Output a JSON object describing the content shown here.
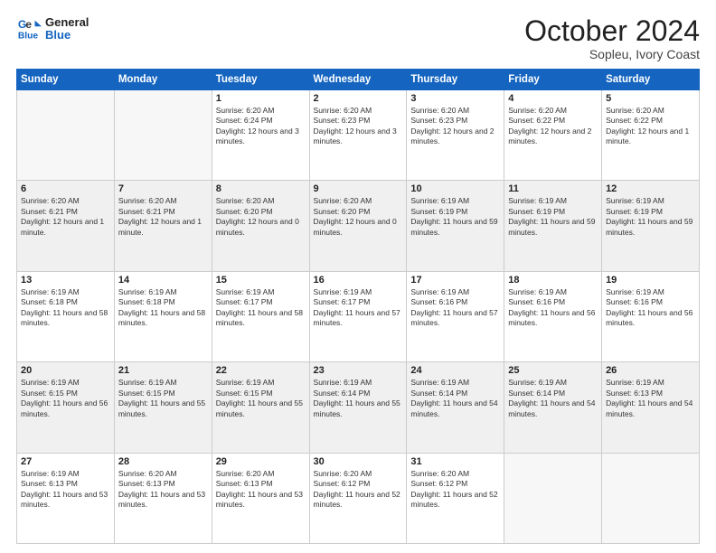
{
  "logo": {
    "line1": "General",
    "line2": "Blue"
  },
  "header": {
    "month": "October 2024",
    "location": "Sopleu, Ivory Coast"
  },
  "weekdays": [
    "Sunday",
    "Monday",
    "Tuesday",
    "Wednesday",
    "Thursday",
    "Friday",
    "Saturday"
  ],
  "rows": [
    {
      "shaded": false,
      "cells": [
        {
          "day": "",
          "info": ""
        },
        {
          "day": "",
          "info": ""
        },
        {
          "day": "1",
          "info": "Sunrise: 6:20 AM\nSunset: 6:24 PM\nDaylight: 12 hours and 3 minutes."
        },
        {
          "day": "2",
          "info": "Sunrise: 6:20 AM\nSunset: 6:23 PM\nDaylight: 12 hours and 3 minutes."
        },
        {
          "day": "3",
          "info": "Sunrise: 6:20 AM\nSunset: 6:23 PM\nDaylight: 12 hours and 2 minutes."
        },
        {
          "day": "4",
          "info": "Sunrise: 6:20 AM\nSunset: 6:22 PM\nDaylight: 12 hours and 2 minutes."
        },
        {
          "day": "5",
          "info": "Sunrise: 6:20 AM\nSunset: 6:22 PM\nDaylight: 12 hours and 1 minute."
        }
      ]
    },
    {
      "shaded": true,
      "cells": [
        {
          "day": "6",
          "info": "Sunrise: 6:20 AM\nSunset: 6:21 PM\nDaylight: 12 hours and 1 minute."
        },
        {
          "day": "7",
          "info": "Sunrise: 6:20 AM\nSunset: 6:21 PM\nDaylight: 12 hours and 1 minute."
        },
        {
          "day": "8",
          "info": "Sunrise: 6:20 AM\nSunset: 6:20 PM\nDaylight: 12 hours and 0 minutes."
        },
        {
          "day": "9",
          "info": "Sunrise: 6:20 AM\nSunset: 6:20 PM\nDaylight: 12 hours and 0 minutes."
        },
        {
          "day": "10",
          "info": "Sunrise: 6:19 AM\nSunset: 6:19 PM\nDaylight: 11 hours and 59 minutes."
        },
        {
          "day": "11",
          "info": "Sunrise: 6:19 AM\nSunset: 6:19 PM\nDaylight: 11 hours and 59 minutes."
        },
        {
          "day": "12",
          "info": "Sunrise: 6:19 AM\nSunset: 6:19 PM\nDaylight: 11 hours and 59 minutes."
        }
      ]
    },
    {
      "shaded": false,
      "cells": [
        {
          "day": "13",
          "info": "Sunrise: 6:19 AM\nSunset: 6:18 PM\nDaylight: 11 hours and 58 minutes."
        },
        {
          "day": "14",
          "info": "Sunrise: 6:19 AM\nSunset: 6:18 PM\nDaylight: 11 hours and 58 minutes."
        },
        {
          "day": "15",
          "info": "Sunrise: 6:19 AM\nSunset: 6:17 PM\nDaylight: 11 hours and 58 minutes."
        },
        {
          "day": "16",
          "info": "Sunrise: 6:19 AM\nSunset: 6:17 PM\nDaylight: 11 hours and 57 minutes."
        },
        {
          "day": "17",
          "info": "Sunrise: 6:19 AM\nSunset: 6:16 PM\nDaylight: 11 hours and 57 minutes."
        },
        {
          "day": "18",
          "info": "Sunrise: 6:19 AM\nSunset: 6:16 PM\nDaylight: 11 hours and 56 minutes."
        },
        {
          "day": "19",
          "info": "Sunrise: 6:19 AM\nSunset: 6:16 PM\nDaylight: 11 hours and 56 minutes."
        }
      ]
    },
    {
      "shaded": true,
      "cells": [
        {
          "day": "20",
          "info": "Sunrise: 6:19 AM\nSunset: 6:15 PM\nDaylight: 11 hours and 56 minutes."
        },
        {
          "day": "21",
          "info": "Sunrise: 6:19 AM\nSunset: 6:15 PM\nDaylight: 11 hours and 55 minutes."
        },
        {
          "day": "22",
          "info": "Sunrise: 6:19 AM\nSunset: 6:15 PM\nDaylight: 11 hours and 55 minutes."
        },
        {
          "day": "23",
          "info": "Sunrise: 6:19 AM\nSunset: 6:14 PM\nDaylight: 11 hours and 55 minutes."
        },
        {
          "day": "24",
          "info": "Sunrise: 6:19 AM\nSunset: 6:14 PM\nDaylight: 11 hours and 54 minutes."
        },
        {
          "day": "25",
          "info": "Sunrise: 6:19 AM\nSunset: 6:14 PM\nDaylight: 11 hours and 54 minutes."
        },
        {
          "day": "26",
          "info": "Sunrise: 6:19 AM\nSunset: 6:13 PM\nDaylight: 11 hours and 54 minutes."
        }
      ]
    },
    {
      "shaded": false,
      "cells": [
        {
          "day": "27",
          "info": "Sunrise: 6:19 AM\nSunset: 6:13 PM\nDaylight: 11 hours and 53 minutes."
        },
        {
          "day": "28",
          "info": "Sunrise: 6:20 AM\nSunset: 6:13 PM\nDaylight: 11 hours and 53 minutes."
        },
        {
          "day": "29",
          "info": "Sunrise: 6:20 AM\nSunset: 6:13 PM\nDaylight: 11 hours and 53 minutes."
        },
        {
          "day": "30",
          "info": "Sunrise: 6:20 AM\nSunset: 6:12 PM\nDaylight: 11 hours and 52 minutes."
        },
        {
          "day": "31",
          "info": "Sunrise: 6:20 AM\nSunset: 6:12 PM\nDaylight: 11 hours and 52 minutes."
        },
        {
          "day": "",
          "info": ""
        },
        {
          "day": "",
          "info": ""
        }
      ]
    }
  ]
}
